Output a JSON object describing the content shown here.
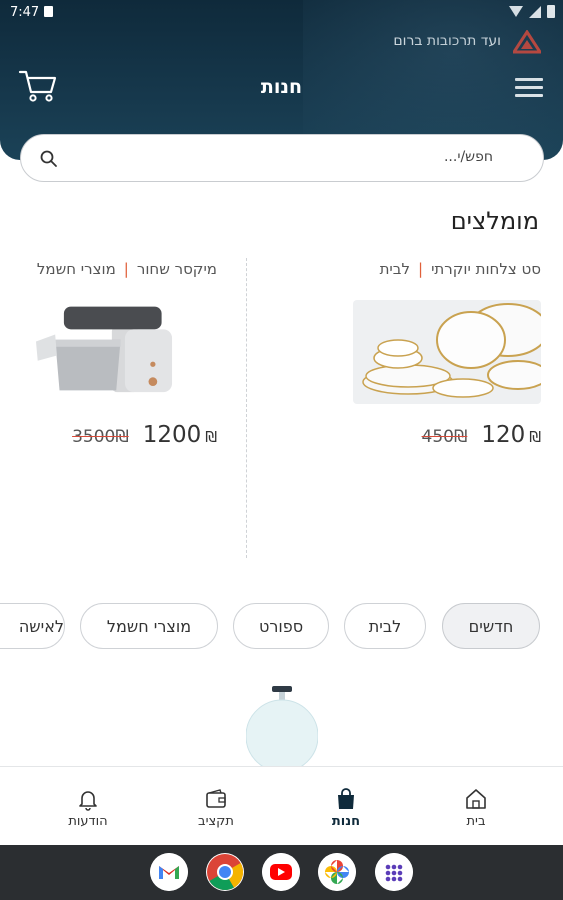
{
  "status_bar": {
    "time": "7:47"
  },
  "header": {
    "org_name": "ועד תרכובות ברום",
    "title": "חנות"
  },
  "search": {
    "placeholder": "חפש/י..."
  },
  "recommended": {
    "title": "מומלצים",
    "products": [
      {
        "name": "סט צלחות יוקרתי",
        "category": "לבית",
        "price": "120",
        "old_price": "450",
        "currency": "₪"
      },
      {
        "name": "מיקסר שחור",
        "category": "מוצרי חשמל",
        "price": "1200",
        "old_price": "3500",
        "currency": "₪"
      }
    ]
  },
  "categories": [
    {
      "label": "חדשים",
      "active": true
    },
    {
      "label": "לבית",
      "active": false
    },
    {
      "label": "ספורט",
      "active": false
    },
    {
      "label": "מוצרי חשמל",
      "active": false
    },
    {
      "label": "לאישה",
      "active": false
    }
  ],
  "bottom_nav": {
    "home": "בית",
    "store": "חנות",
    "budget": "תקציב",
    "notifications": "הודעות",
    "active": "store"
  },
  "dock_apps": [
    "gmail-icon",
    "chrome-icon",
    "youtube-icon",
    "photos-icon",
    "app-drawer-icon"
  ],
  "colors": {
    "header": "#0f2a3b",
    "accent_red": "#d8402f",
    "chip_active_bg": "#f0f1f3"
  }
}
